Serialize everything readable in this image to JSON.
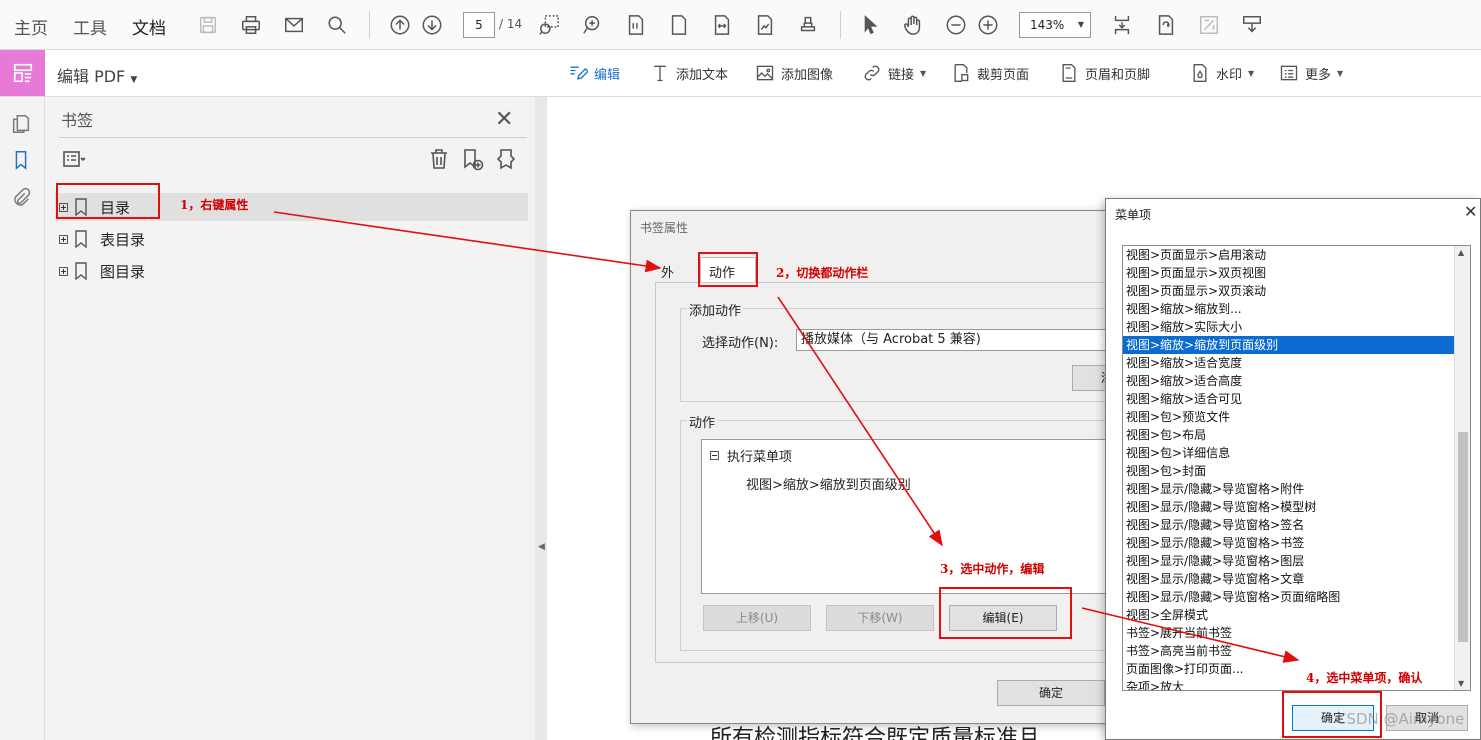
{
  "top_tabs": {
    "home": "主页",
    "tools": "工具",
    "document": "文档"
  },
  "page_nav": {
    "current": "5",
    "total": "/ 14"
  },
  "zoom": "143%",
  "edit_toolbar": {
    "mode_title": "编辑 PDF",
    "edit": "编辑",
    "add_text": "添加文本",
    "add_image": "添加图像",
    "link": "链接",
    "crop": "裁剪页面",
    "header_footer": "页眉和页脚",
    "watermark": "水印",
    "more": "更多"
  },
  "bookmark_panel": {
    "title": "书签",
    "items": [
      {
        "label": "目录"
      },
      {
        "label": "表目录"
      },
      {
        "label": "图目录"
      }
    ]
  },
  "document_text": "所有检测指标符合既定质量标准且",
  "bookmark_properties": {
    "title": "书签属性",
    "tab_appearance": "外观",
    "tab_actions": "动作",
    "add_action_group": "添加动作",
    "select_action_label": "选择动作(N):",
    "select_action_value": "播放媒体（与 Acrobat 5 兼容)",
    "add_button_partial": "添",
    "actions_group": "动作",
    "tree_parent": "执行菜单项",
    "tree_child": "视图>缩放>缩放到页面级别",
    "up_button": "上移(U)",
    "down_button": "下移(W)",
    "edit_button": "编辑(E)",
    "ok_button": "确定"
  },
  "menu_item_dialog": {
    "title": "菜单项",
    "items": [
      "视图>页面显示>启用滚动",
      "视图>页面显示>双页视图",
      "视图>页面显示>双页滚动",
      "视图>缩放>缩放到...",
      "视图>缩放>实际大小",
      "视图>缩放>缩放到页面级别",
      "视图>缩放>适合宽度",
      "视图>缩放>适合高度",
      "视图>缩放>适合可见",
      "视图>包>预览文件",
      "视图>包>布局",
      "视图>包>详细信息",
      "视图>包>封面",
      "视图>显示/隐藏>导览窗格>附件",
      "视图>显示/隐藏>导览窗格>模型树",
      "视图>显示/隐藏>导览窗格>签名",
      "视图>显示/隐藏>导览窗格>书签",
      "视图>显示/隐藏>导览窗格>图层",
      "视图>显示/隐藏>导览窗格>文章",
      "视图>显示/隐藏>导览窗格>页面缩略图",
      "视图>全屏模式",
      "书签>展开当前书签",
      "书签>高亮当前书签",
      "页面图像>打印页面...",
      "杂项>放大"
    ],
    "selected_index": 5,
    "ok_button": "确定",
    "cancel_button": "取消"
  },
  "annotations": {
    "step1": "1，右键属性",
    "step2": "2，切换都动作栏",
    "step3": "3，选中动作，编辑",
    "step4": "4，选中菜单项，确认"
  },
  "watermark": "CSDN @Aimyone",
  "colors": {
    "accent": "#1a73c8",
    "annotation_red": "#e01010",
    "selection_blue": "#0a6cd1",
    "mode_pink": "#e67ad6"
  }
}
